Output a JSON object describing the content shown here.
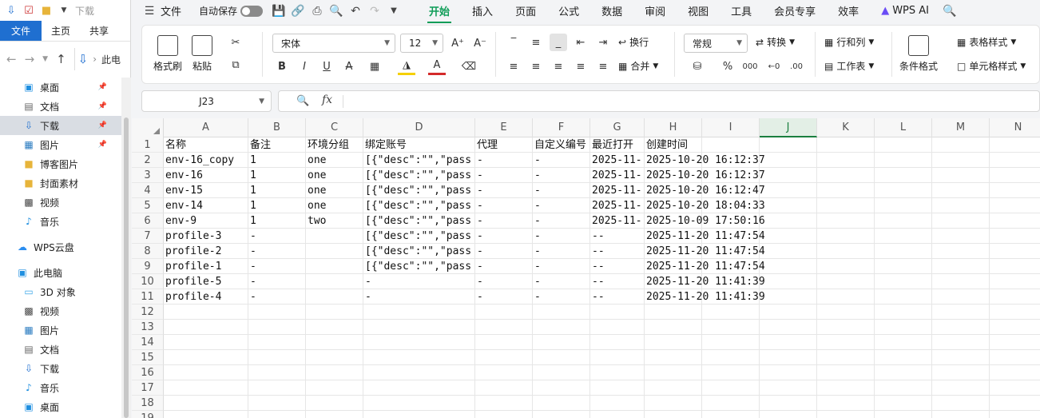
{
  "explorer": {
    "title": "下载",
    "tabs": [
      "文件",
      "主页",
      "共享"
    ],
    "address": "此电",
    "tree": [
      {
        "label": "桌面",
        "icon": "desktop-icon",
        "pinned": true
      },
      {
        "label": "文档",
        "icon": "document-icon",
        "pinned": true
      },
      {
        "label": "下载",
        "icon": "download-icon",
        "pinned": true,
        "selected": true
      },
      {
        "label": "图片",
        "icon": "picture-icon",
        "pinned": true
      },
      {
        "label": "博客图片",
        "icon": "folder-icon",
        "pinned": false
      },
      {
        "label": "封面素材",
        "icon": "folder-icon",
        "pinned": false
      },
      {
        "label": "视频",
        "icon": "video-icon",
        "pinned": false
      },
      {
        "label": "音乐",
        "icon": "music-icon",
        "pinned": false
      },
      {
        "label": "WPS云盘",
        "icon": "cloud-icon",
        "root": true
      },
      {
        "label": "此电脑",
        "icon": "computer-icon",
        "root": true
      },
      {
        "label": "3D 对象",
        "icon": "cube-icon"
      },
      {
        "label": "视频",
        "icon": "video-icon"
      },
      {
        "label": "图片",
        "icon": "picture-icon"
      },
      {
        "label": "文档",
        "icon": "document-icon"
      },
      {
        "label": "下载",
        "icon": "download-icon"
      },
      {
        "label": "音乐",
        "icon": "music-icon"
      },
      {
        "label": "桌面",
        "icon": "desktop-icon"
      }
    ]
  },
  "menubar": {
    "file": "文件",
    "autosave": "自动保存",
    "tabs": [
      "开始",
      "插入",
      "页面",
      "公式",
      "数据",
      "审阅",
      "视图",
      "工具",
      "会员专享",
      "效率"
    ],
    "wps_ai": "WPS AI"
  },
  "ribbon": {
    "format_painter": "格式刷",
    "paste": "粘贴",
    "font_name": "宋体",
    "font_size": "12",
    "wrap": "换行",
    "merge": "合并",
    "number_format": "常规",
    "convert": "转换",
    "rows_cols": "行和列",
    "worksheet": "工作表",
    "conditional_format": "条件格式",
    "table_style": "表格样式",
    "cell_style": "单元格样式",
    "accent_color": "#0f9d58"
  },
  "formula_bar": {
    "cell_ref": "J23",
    "fx": "fx",
    "content": ""
  },
  "sheet": {
    "active_column": "J",
    "columns": [
      "A",
      "B",
      "C",
      "D",
      "E",
      "F",
      "G",
      "H",
      "I",
      "J",
      "K",
      "L",
      "M",
      "N"
    ],
    "row_numbers": [
      "1",
      "2",
      "3",
      "4",
      "5",
      "6",
      "7",
      "8",
      "9",
      "10",
      "11",
      "12",
      "13",
      "14",
      "15",
      "16",
      "17",
      "18",
      "19"
    ],
    "header": [
      "名称",
      "备注",
      "环境分组",
      "绑定账号",
      "代理",
      "自定义编号",
      "最近打开",
      "创建时间"
    ],
    "rows": [
      [
        "env-16_copy",
        "1",
        "one",
        "[{\"desc\":\"\",\"pass",
        "-",
        "-",
        "2025-11-",
        "2025-10-20 16:12:37"
      ],
      [
        "env-16",
        "1",
        "one",
        "[{\"desc\":\"\",\"pass",
        "-",
        "-",
        "2025-11-",
        "2025-10-20 16:12:37"
      ],
      [
        "env-15",
        "1",
        "one",
        "[{\"desc\":\"\",\"pass",
        "-",
        "-",
        "2025-11-",
        "2025-10-20 16:12:47"
      ],
      [
        "env-14",
        "1",
        "one",
        "[{\"desc\":\"\",\"pass",
        "-",
        "-",
        "2025-11-",
        "2025-10-20 18:04:33"
      ],
      [
        "env-9",
        "1",
        "two",
        "[{\"desc\":\"\",\"pass",
        "-",
        "-",
        "2025-11-",
        "2025-10-09 17:50:16"
      ],
      [
        "profile-3",
        "-",
        "",
        "[{\"desc\":\"\",\"pass",
        "-",
        "-",
        "--",
        "2025-11-20 11:47:54"
      ],
      [
        "profile-2",
        "-",
        "",
        "[{\"desc\":\"\",\"pass",
        "-",
        "-",
        "--",
        "2025-11-20 11:47:54"
      ],
      [
        "profile-1",
        "-",
        "",
        "[{\"desc\":\"\",\"pass",
        "-",
        "-",
        "--",
        "2025-11-20 11:47:54"
      ],
      [
        "profile-5",
        "-",
        "",
        "-",
        "-",
        "-",
        "--",
        "2025-11-20 11:41:39"
      ],
      [
        "profile-4",
        "-",
        "",
        "-",
        "-",
        "-",
        "--",
        "2025-11-20 11:41:39"
      ]
    ]
  }
}
